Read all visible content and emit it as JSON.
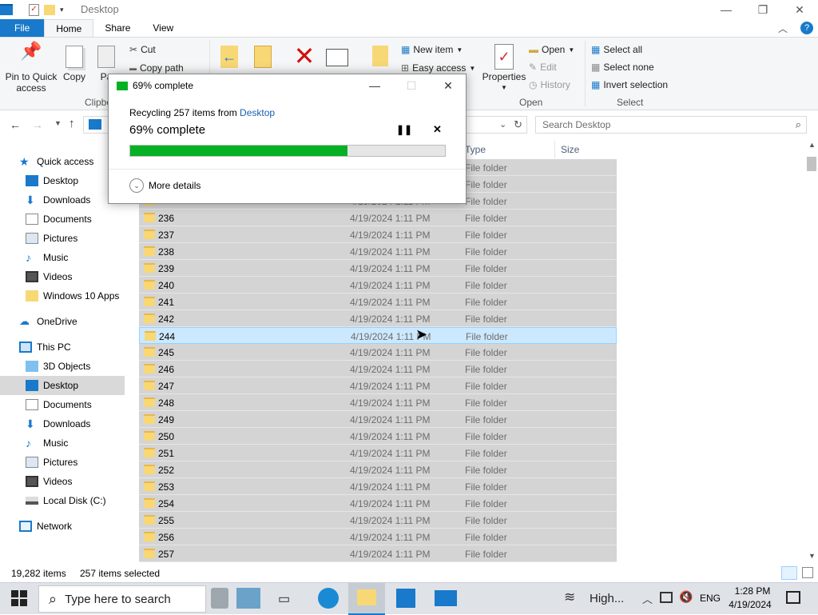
{
  "window": {
    "title": "Desktop"
  },
  "tabs": [
    "File",
    "Home",
    "Share",
    "View"
  ],
  "ribbon": {
    "pin_label": "Pin to Quick access",
    "copy_label": "Copy",
    "paste_label": "Pa",
    "cut_label": "Cut",
    "copy_path_label": "Copy path",
    "clipboard_group": "Clipbo",
    "new_item_label": "New item",
    "easy_access_label": "Easy access",
    "properties_label": "Properties",
    "open_label": "Open",
    "edit_label": "Edit",
    "history_label": "History",
    "open_group": "Open",
    "select_all_label": "Select all",
    "select_none_label": "Select none",
    "invert_selection_label": "Invert selection",
    "select_group": "Select"
  },
  "search": {
    "placeholder": "Search Desktop"
  },
  "columns": {
    "type": "Type",
    "size": "Size"
  },
  "nav": {
    "quick_access": "Quick access",
    "quick_items": [
      "Desktop",
      "Downloads",
      "Documents",
      "Pictures",
      "Music",
      "Videos",
      "Windows 10 Apps"
    ],
    "onedrive": "OneDrive",
    "this_pc": "This PC",
    "pc_items": [
      "3D Objects",
      "Desktop",
      "Documents",
      "Downloads",
      "Music",
      "Pictures",
      "Videos",
      "Local Disk (C:)"
    ],
    "network": "Network"
  },
  "rows": [
    {
      "name": "",
      "date": "",
      "type": "File folder"
    },
    {
      "name": "",
      "date": "",
      "type": "File folder"
    },
    {
      "name": "",
      "date": "4/19/2024 1:11 PM",
      "type": "File folder"
    },
    {
      "name": "236",
      "date": "4/19/2024 1:11 PM",
      "type": "File folder"
    },
    {
      "name": "237",
      "date": "4/19/2024 1:11 PM",
      "type": "File folder"
    },
    {
      "name": "238",
      "date": "4/19/2024 1:11 PM",
      "type": "File folder"
    },
    {
      "name": "239",
      "date": "4/19/2024 1:11 PM",
      "type": "File folder"
    },
    {
      "name": "240",
      "date": "4/19/2024 1:11 PM",
      "type": "File folder"
    },
    {
      "name": "241",
      "date": "4/19/2024 1:11 PM",
      "type": "File folder"
    },
    {
      "name": "242",
      "date": "4/19/2024 1:11 PM",
      "type": "File folder"
    },
    {
      "name": "244",
      "date": "4/19/2024 1:11 PM",
      "type": "File folder"
    },
    {
      "name": "245",
      "date": "4/19/2024 1:11 PM",
      "type": "File folder"
    },
    {
      "name": "246",
      "date": "4/19/2024 1:11 PM",
      "type": "File folder"
    },
    {
      "name": "247",
      "date": "4/19/2024 1:11 PM",
      "type": "File folder"
    },
    {
      "name": "248",
      "date": "4/19/2024 1:11 PM",
      "type": "File folder"
    },
    {
      "name": "249",
      "date": "4/19/2024 1:11 PM",
      "type": "File folder"
    },
    {
      "name": "250",
      "date": "4/19/2024 1:11 PM",
      "type": "File folder"
    },
    {
      "name": "251",
      "date": "4/19/2024 1:11 PM",
      "type": "File folder"
    },
    {
      "name": "252",
      "date": "4/19/2024 1:11 PM",
      "type": "File folder"
    },
    {
      "name": "253",
      "date": "4/19/2024 1:11 PM",
      "type": "File folder"
    },
    {
      "name": "254",
      "date": "4/19/2024 1:11 PM",
      "type": "File folder"
    },
    {
      "name": "255",
      "date": "4/19/2024 1:11 PM",
      "type": "File folder"
    },
    {
      "name": "256",
      "date": "4/19/2024 1:11 PM",
      "type": "File folder"
    },
    {
      "name": "257",
      "date": "4/19/2024 1:11 PM",
      "type": "File folder"
    }
  ],
  "highlighted_row": 10,
  "status": {
    "items": "19,282 items",
    "selected": "257 items selected"
  },
  "dialog": {
    "title": "69% complete",
    "recycling_prefix": "Recycling 257 items from ",
    "recycling_source": "Desktop",
    "percent_label": "69% complete",
    "progress": 0.69,
    "more_details": "More details"
  },
  "taskbar": {
    "search_placeholder": "Type here to search",
    "weather": "High...",
    "language": "ENG",
    "time": "1:28 PM",
    "date": "4/19/2024"
  },
  "colors": {
    "accent": "#1979ca",
    "progress": "#06b025",
    "selection": "#cce8ff"
  }
}
